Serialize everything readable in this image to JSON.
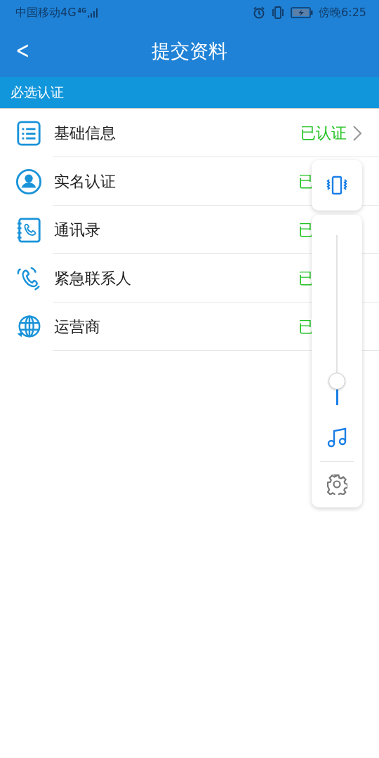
{
  "status_bar": {
    "carrier": "中国移动4G",
    "network": "4G",
    "time": "傍晚6:25"
  },
  "header": {
    "back": "<",
    "title": "提交资料"
  },
  "section": {
    "title": "必选认证"
  },
  "rows": [
    {
      "kind": "list",
      "label": "基础信息",
      "status": "已认证",
      "chevron": true
    },
    {
      "kind": "person",
      "label": "实名认证",
      "status": "已",
      "chevron": false
    },
    {
      "kind": "contacts",
      "label": "通讯录",
      "status": "已",
      "chevron": false
    },
    {
      "kind": "phone",
      "label": "紧急联系人",
      "status": "已",
      "chevron": false
    },
    {
      "kind": "globe",
      "label": "运营商",
      "status": "已",
      "chevron": false
    }
  ],
  "volume_panel": {
    "level": 0.14
  }
}
